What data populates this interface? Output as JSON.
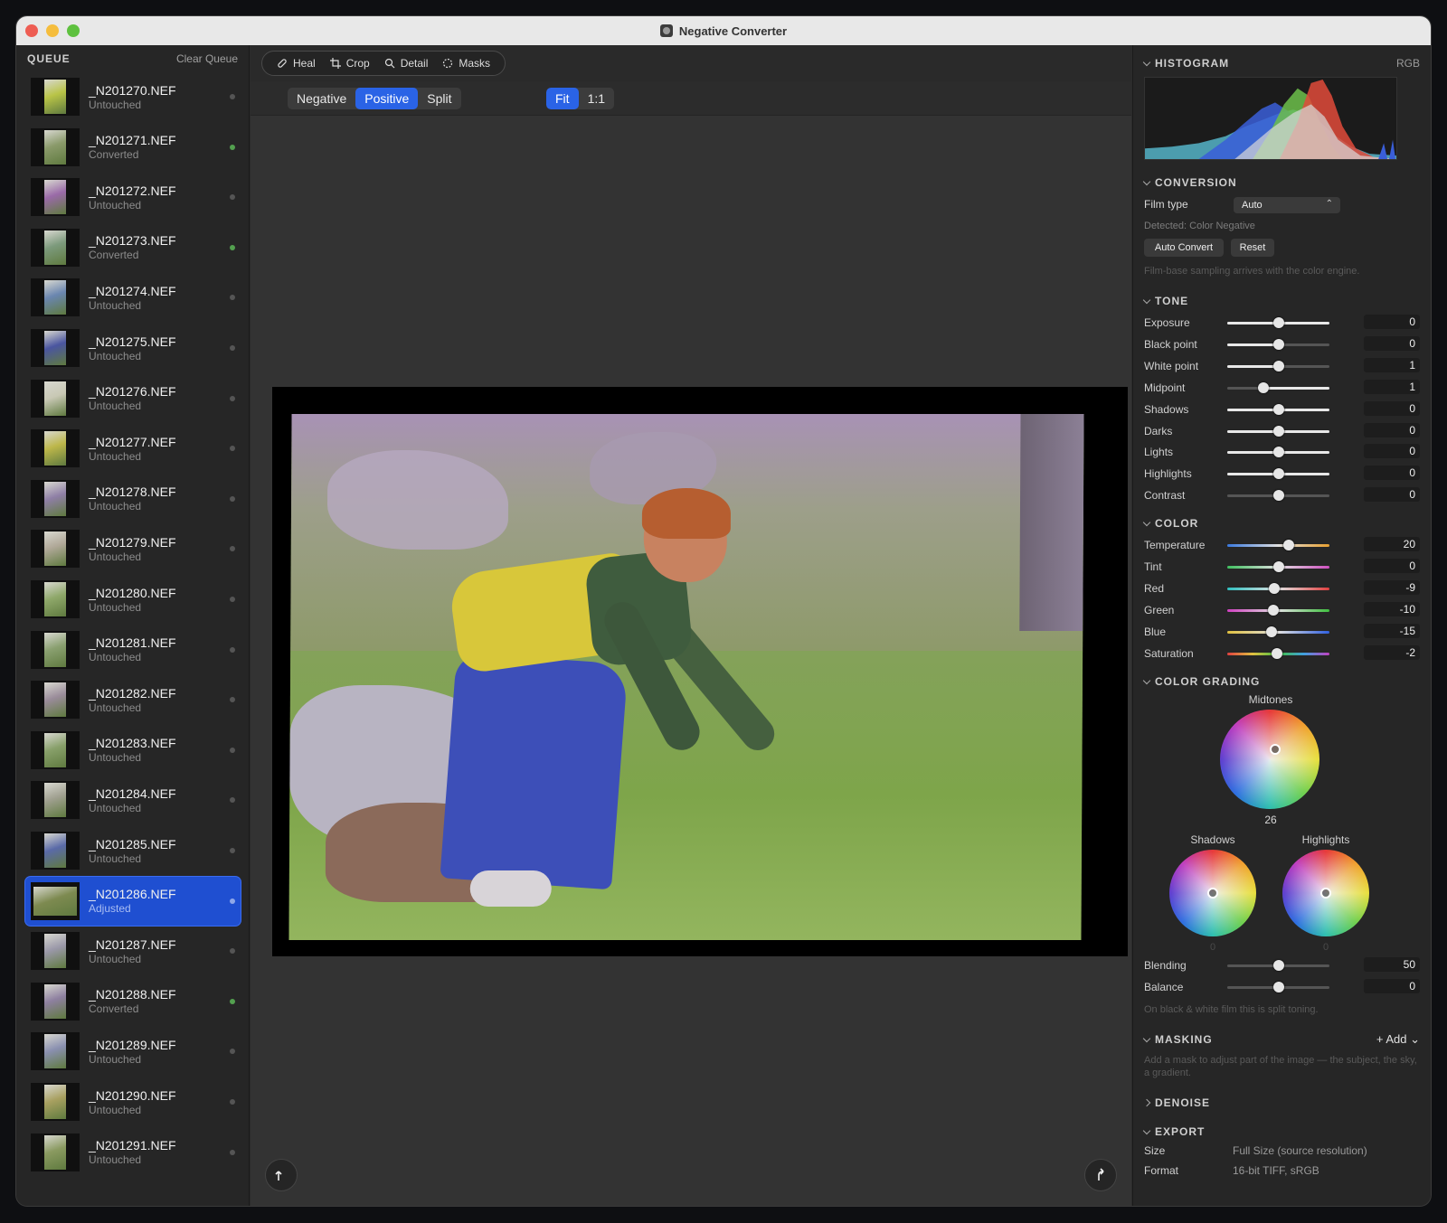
{
  "window": {
    "title": "Negative Converter"
  },
  "queue": {
    "title": "QUEUE",
    "clear_label": "Clear Queue",
    "items": [
      {
        "name": "_N201270.NEF",
        "status": "Untouched",
        "thumb": "#b9c447"
      },
      {
        "name": "_N201271.NEF",
        "status": "Converted",
        "thumb": "#8a9a6a"
      },
      {
        "name": "_N201272.NEF",
        "status": "Untouched",
        "thumb": "#9a6aa8"
      },
      {
        "name": "_N201273.NEF",
        "status": "Converted",
        "thumb": "#7c9a7c"
      },
      {
        "name": "_N201274.NEF",
        "status": "Untouched",
        "thumb": "#6a86b0"
      },
      {
        "name": "_N201275.NEF",
        "status": "Untouched",
        "thumb": "#4a55a0"
      },
      {
        "name": "_N201276.NEF",
        "status": "Untouched",
        "thumb": "#c8c8b4"
      },
      {
        "name": "_N201277.NEF",
        "status": "Untouched",
        "thumb": "#bdb74a"
      },
      {
        "name": "_N201278.NEF",
        "status": "Untouched",
        "thumb": "#8f7fa6"
      },
      {
        "name": "_N201279.NEF",
        "status": "Untouched",
        "thumb": "#b0a898"
      },
      {
        "name": "_N201280.NEF",
        "status": "Untouched",
        "thumb": "#8fa86a"
      },
      {
        "name": "_N201281.NEF",
        "status": "Untouched",
        "thumb": "#8aa070"
      },
      {
        "name": "_N201282.NEF",
        "status": "Untouched",
        "thumb": "#9a8c9a"
      },
      {
        "name": "_N201283.NEF",
        "status": "Untouched",
        "thumb": "#88a06a"
      },
      {
        "name": "_N201284.NEF",
        "status": "Untouched",
        "thumb": "#a0a090"
      },
      {
        "name": "_N201285.NEF",
        "status": "Untouched",
        "thumb": "#5a6aa8"
      },
      {
        "name": "_N201286.NEF",
        "status": "Adjusted",
        "thumb": "#7d8a50"
      },
      {
        "name": "_N201287.NEF",
        "status": "Untouched",
        "thumb": "#9a98a8"
      },
      {
        "name": "_N201288.NEF",
        "status": "Converted",
        "thumb": "#8e80a0"
      },
      {
        "name": "_N201289.NEF",
        "status": "Untouched",
        "thumb": "#8a90b0"
      },
      {
        "name": "_N201290.NEF",
        "status": "Untouched",
        "thumb": "#a8a060"
      },
      {
        "name": "_N201291.NEF",
        "status": "Untouched",
        "thumb": "#8a9a60"
      }
    ]
  },
  "tools": {
    "heal": "Heal",
    "crop": "Crop",
    "detail": "Detail",
    "masks": "Masks"
  },
  "view": {
    "negative": "Negative",
    "positive": "Positive",
    "split": "Split",
    "fit": "Fit",
    "one_to_one": "1:1"
  },
  "inspector": {
    "histogram": {
      "title": "HISTOGRAM",
      "mode": "RGB"
    },
    "conversion": {
      "title": "CONVERSION",
      "film_type_label": "Film type",
      "film_type_value": "Auto",
      "detected": "Detected: Color Negative",
      "auto_convert": "Auto Convert",
      "reset": "Reset",
      "note": "Film-base sampling arrives with the color engine."
    },
    "tone": {
      "title": "TONE",
      "sliders": [
        {
          "label": "Exposure",
          "value": "0",
          "pos": 0.5,
          "fill": "center"
        },
        {
          "label": "Black point",
          "value": "0",
          "pos": 0.5,
          "fill": "left"
        },
        {
          "label": "White point",
          "value": "1",
          "pos": 0.5,
          "fill": "left"
        },
        {
          "label": "Midpoint",
          "value": "1",
          "pos": 0.35,
          "fill": "right"
        },
        {
          "label": "Shadows",
          "value": "0",
          "pos": 0.5,
          "fill": "center"
        },
        {
          "label": "Darks",
          "value": "0",
          "pos": 0.5,
          "fill": "center"
        },
        {
          "label": "Lights",
          "value": "0",
          "pos": 0.5,
          "fill": "center"
        },
        {
          "label": "Highlights",
          "value": "0",
          "pos": 0.5,
          "fill": "center"
        },
        {
          "label": "Contrast",
          "value": "0",
          "pos": 0.5,
          "fill": "none"
        }
      ]
    },
    "color": {
      "title": "COLOR",
      "sliders": [
        {
          "label": "Temperature",
          "value": "20",
          "pos": 0.6,
          "grad": "linear-gradient(90deg,#3a7ae0,#e0e0e0,#e8a030)"
        },
        {
          "label": "Tint",
          "value": "0",
          "pos": 0.5,
          "grad": "linear-gradient(90deg,#40c060,#e0e0e0,#d050c0)"
        },
        {
          "label": "Red",
          "value": "-9",
          "pos": 0.46,
          "grad": "linear-gradient(90deg,#30c0c0,#e0e0e0,#e04040)"
        },
        {
          "label": "Green",
          "value": "-10",
          "pos": 0.45,
          "grad": "linear-gradient(90deg,#d040c0,#e0e0e0,#40c040)"
        },
        {
          "label": "Blue",
          "value": "-15",
          "pos": 0.43,
          "grad": "linear-gradient(90deg,#e0c040,#e0e0e0,#3060e0)"
        },
        {
          "label": "Saturation",
          "value": "-2",
          "pos": 0.49,
          "grad": "linear-gradient(90deg,#e04040,#e0c040,#40c040,#40a0e0,#c040c0)"
        }
      ]
    },
    "grading": {
      "title": "COLOR GRADING",
      "midtones_label": "Midtones",
      "midtones_value": "26",
      "shadows_label": "Shadows",
      "shadows_value": "0",
      "highlights_label": "Highlights",
      "highlights_value": "0",
      "blending_label": "Blending",
      "blending_value": "50",
      "balance_label": "Balance",
      "balance_value": "0",
      "note": "On black & white film this is split toning."
    },
    "masking": {
      "title": "MASKING",
      "add_label": "+ Add ⌄",
      "note": "Add a mask to adjust part of the image — the subject, the sky, a gradient."
    },
    "denoise": {
      "title": "DENOISE"
    },
    "export": {
      "title": "EXPORT",
      "size_label": "Size",
      "size_value": "Full Size (source resolution)",
      "format_label": "Format",
      "format_value": "16-bit TIFF, sRGB"
    }
  }
}
